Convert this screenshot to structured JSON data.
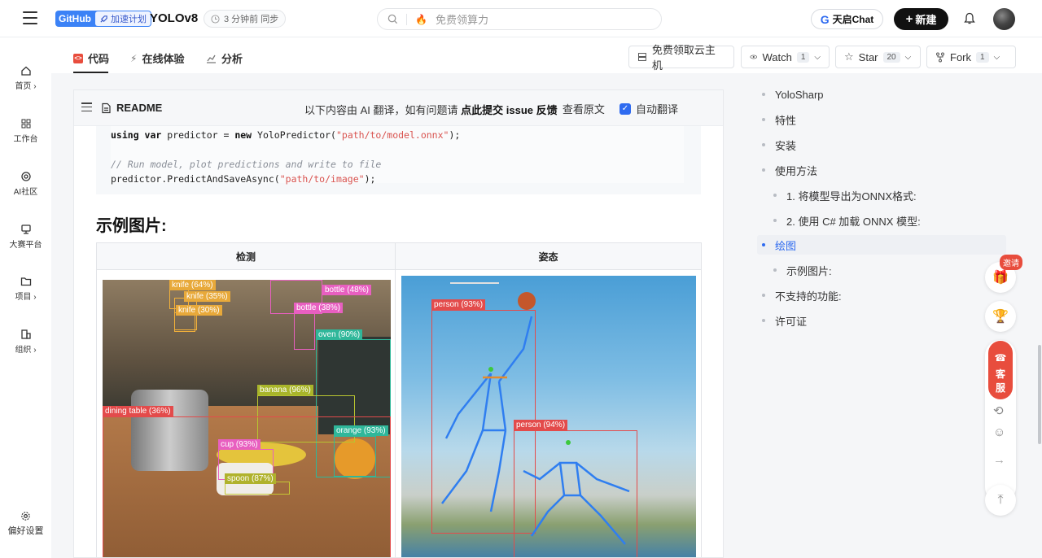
{
  "topbar": {
    "github": "GitHub",
    "speed": "加速计划",
    "repo": "YOLOv8",
    "sync": "3 分钟前 同步",
    "search_placeholder": "免费领算力",
    "tianqi": "天启Chat",
    "new": "新建"
  },
  "leftnav": {
    "items": [
      {
        "label": "首页 ›"
      },
      {
        "label": "工作台"
      },
      {
        "label": "AI社区"
      },
      {
        "label": "大赛平台"
      },
      {
        "label": "项目 ›"
      },
      {
        "label": "组织 ›"
      }
    ],
    "settings": "偏好设置"
  },
  "subnav": {
    "tabs": [
      "代码",
      "在线体验",
      "分析"
    ],
    "cloud": "免费领取云主机",
    "watch": "Watch",
    "watch_count": "1",
    "star": "Star",
    "star_count": "20",
    "fork": "Fork",
    "fork_count": "1"
  },
  "readme": {
    "title": "README",
    "ai_note_prefix": "以下内容由 AI 翻译，如有问题请",
    "ai_note_link": "点此提交 issue 反馈",
    "original": "查看原文",
    "auto": "自动翻译"
  },
  "code": {
    "l1_kw1": "using var",
    "l1_mid": " predictor = ",
    "l1_kw2": "new",
    "l1_call": " YoloPredictor(",
    "l1_str": "\"path/to/model.onnx\"",
    "l1_end": ");",
    "comment": "// Run model, plot predictions and write to file",
    "l3_call": "predictor.PredictAndSaveAsync(",
    "l3_str": "\"path/to/image\"",
    "l3_end": ");"
  },
  "section_title": "示例图片:",
  "table": {
    "col1": "检测",
    "col2": "姿态"
  },
  "detect_labels": {
    "knife1": "knife (64%)",
    "knife2": "knife (35%)",
    "knife3": "knife (30%)",
    "bottle1": "bottle (48%)",
    "bottle2": "bottle (38%)",
    "oven": "oven (90%)",
    "banana": "banana (96%)",
    "dining": "dining table (36%)",
    "orange": "orange (93%)",
    "cup": "cup (93%)",
    "spoon": "spoon (87%)"
  },
  "pose_labels": {
    "p1": "person (93%)",
    "p2": "person (94%)"
  },
  "toc": {
    "items": [
      "YoloSharp",
      "特性",
      "安装",
      "使用方法",
      "1. 将模型导出为ONNX格式:",
      "2. 使用 C# 加载 ONNX 模型:",
      "绘图",
      "示例图片:",
      "不支持的功能:",
      "许可证"
    ]
  },
  "floats": {
    "invite": "邀请",
    "kefu1": "客",
    "kefu2": "服"
  },
  "colors": {
    "accent": "#2f6bf0",
    "red": "#e84d3d"
  }
}
